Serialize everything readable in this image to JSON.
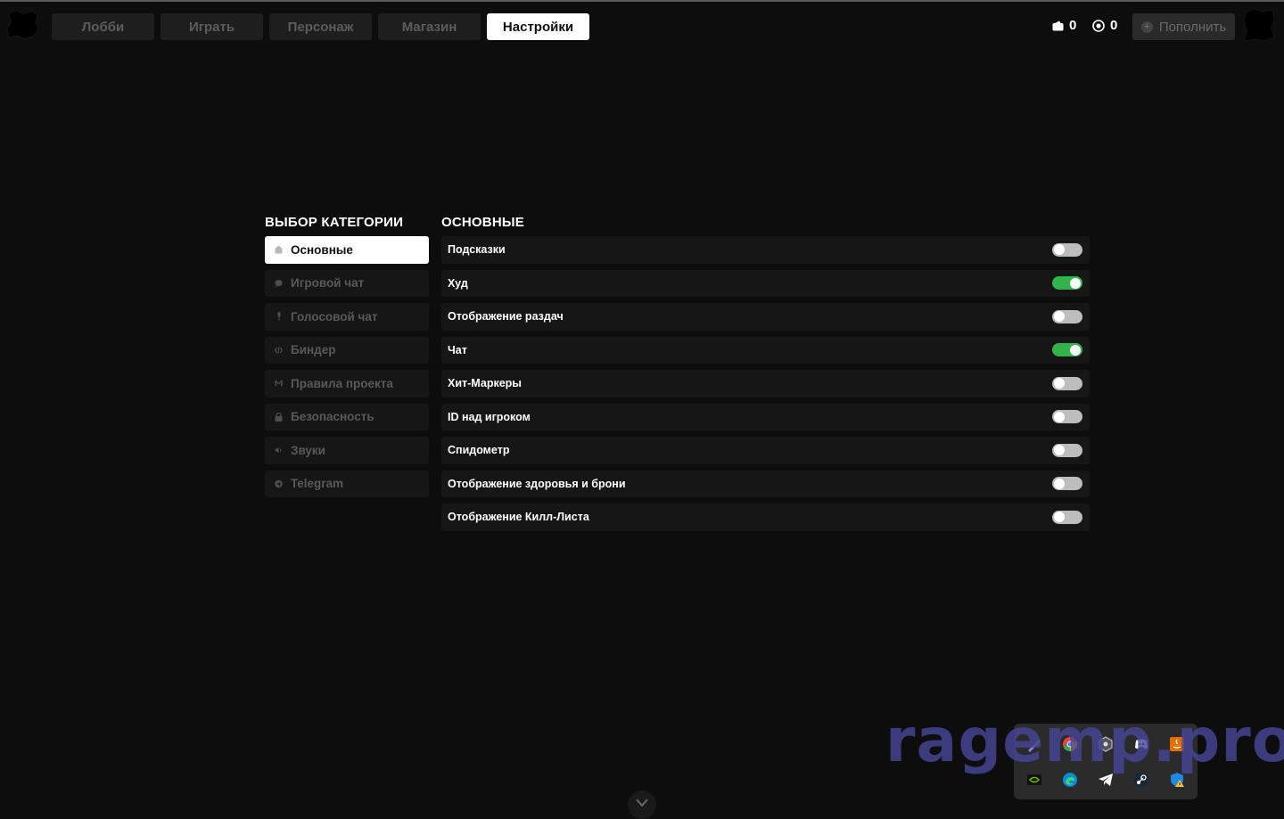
{
  "nav": {
    "tabs": [
      {
        "label": "Лобби",
        "active": false
      },
      {
        "label": "Играть",
        "active": false
      },
      {
        "label": "Персонаж",
        "active": false
      },
      {
        "label": "Магазин",
        "active": false
      },
      {
        "label": "Настройки",
        "active": true
      }
    ]
  },
  "currency": {
    "coins": "0",
    "donate": "0"
  },
  "topup_label": "Пополнить",
  "categories": {
    "title": "ВЫБОР КАТЕГОРИИ",
    "items": [
      {
        "label": "Основные",
        "icon": "home-icon",
        "active": true
      },
      {
        "label": "Игровой чат",
        "icon": "chat-bubble-icon",
        "active": false
      },
      {
        "label": "Голосовой чат",
        "icon": "microphone-icon",
        "active": false
      },
      {
        "label": "Биндер",
        "icon": "code-icon",
        "active": false
      },
      {
        "label": "Правила проекта",
        "icon": "rules-icon",
        "active": false
      },
      {
        "label": "Безопасность",
        "icon": "lock-icon",
        "active": false
      },
      {
        "label": "Звуки",
        "icon": "speaker-icon",
        "active": false
      },
      {
        "label": "Telegram",
        "icon": "telegram-icon",
        "active": false
      }
    ]
  },
  "settings": {
    "title": "ОСНОВНЫЕ",
    "items": [
      {
        "label": "Подсказки",
        "enabled": false
      },
      {
        "label": "Худ",
        "enabled": true
      },
      {
        "label": "Отображение раздач",
        "enabled": false
      },
      {
        "label": "Чат",
        "enabled": true
      },
      {
        "label": "Хит-Маркеры",
        "enabled": false
      },
      {
        "label": "ID над игроком",
        "enabled": false
      },
      {
        "label": "Спидометр",
        "enabled": false
      },
      {
        "label": "Отображение здоровья и брони",
        "enabled": false
      },
      {
        "label": "Отображение Килл-Листа",
        "enabled": false
      }
    ]
  },
  "watermark": "ragemp.pro",
  "colors": {
    "toggle_on": "#32b44a",
    "toggle_off": "#bdbdbd",
    "active_tab_bg": "#ffffff",
    "inactive_tab_bg": "#1e1e1e"
  },
  "tray_icons": [
    "pen-icon",
    "chrome-icon",
    "hex-app-icon",
    "discord-icon",
    "java-icon",
    "nvidia-icon",
    "edge-icon",
    "telegram-icon",
    "steam-icon",
    "security-warning-icon"
  ]
}
